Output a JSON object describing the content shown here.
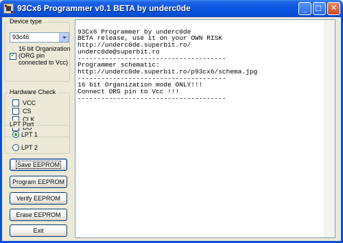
{
  "window": {
    "title": "93Cx6 Programmer v0.1 BETA by underc0de",
    "minimize_glyph": "_",
    "maximize_glyph": "□",
    "close_glyph": "✕"
  },
  "device_type": {
    "group_label": "Device type",
    "selected": "93c46",
    "org_checkbox_checked": true,
    "org_label_lines": [
      "16 bit Organization",
      "(ORG pin",
      "connected to Vcc)"
    ]
  },
  "hardware_check": {
    "group_label": "Hardware Check",
    "items": [
      {
        "label": "VCC",
        "checked": false
      },
      {
        "label": "CS",
        "checked": false
      },
      {
        "label": "CLK",
        "checked": false
      },
      {
        "label": "DO",
        "checked": false
      }
    ]
  },
  "lpt_port": {
    "group_label": "LPT Port",
    "options": [
      {
        "label": "LPT 1",
        "selected": true
      },
      {
        "label": "LPT 2",
        "selected": false
      }
    ]
  },
  "buttons": {
    "save": "Save EEPROM",
    "program": "Program EEPROM",
    "verify": "Verify EEPROM",
    "erase": "Erase EEPROM",
    "exit": "Exit"
  },
  "log": {
    "lines": [
      "93Cx6 Programmer by underc0de",
      "BETA release, use it on your OWN RISK",
      "http://underc0de.superbit.ro/",
      "underc0de@superbit.ro",
      "--------------------------------------",
      "Programmer schematic:",
      "http://underc0de.superbit.ro/p93cx6/schema.jpg",
      "--------------------------------------",
      "16 bit Organization mode ONLY!!!",
      "Connect ORG pin to Vcc !!!",
      "--------------------------------------"
    ]
  },
  "colors": {
    "titlebar": "#0a55e0",
    "window_bg": "#ece9d8",
    "check_green": "#21a121"
  }
}
